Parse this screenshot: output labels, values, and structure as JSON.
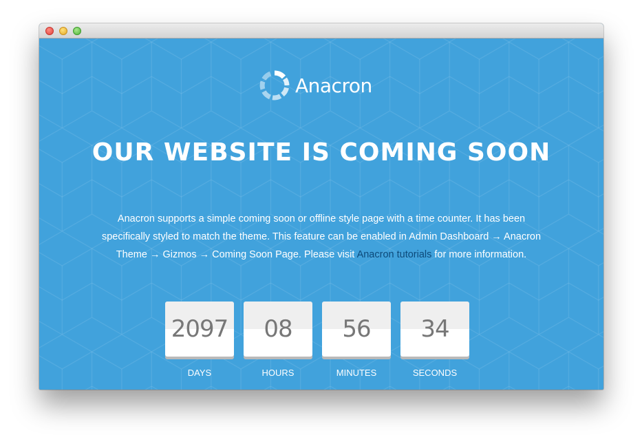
{
  "brand": {
    "name": "Anacron",
    "logo_icon": "segmented-ring-logo"
  },
  "headline": "OUR WEBSITE IS COMING SOON",
  "description": {
    "text_before_link": "Anacron supports a simple coming soon or offline style page with a time counter. It has been specifically styled to match the theme. This feature can be enabled in Admin Dashboard → Anacron Theme → Gizmos → Coming Soon Page. Please visit ",
    "link_text": "Anacron tutorials",
    "text_after_link": " for more information."
  },
  "countdown": [
    {
      "value": "2097",
      "label": "DAYS"
    },
    {
      "value": "08",
      "label": "HOURS"
    },
    {
      "value": "56",
      "label": "MINUTES"
    },
    {
      "value": "34",
      "label": "SECONDS"
    }
  ],
  "colors": {
    "background": "#41a2dc",
    "link": "#0d4a7a",
    "counter_text": "#777777"
  }
}
